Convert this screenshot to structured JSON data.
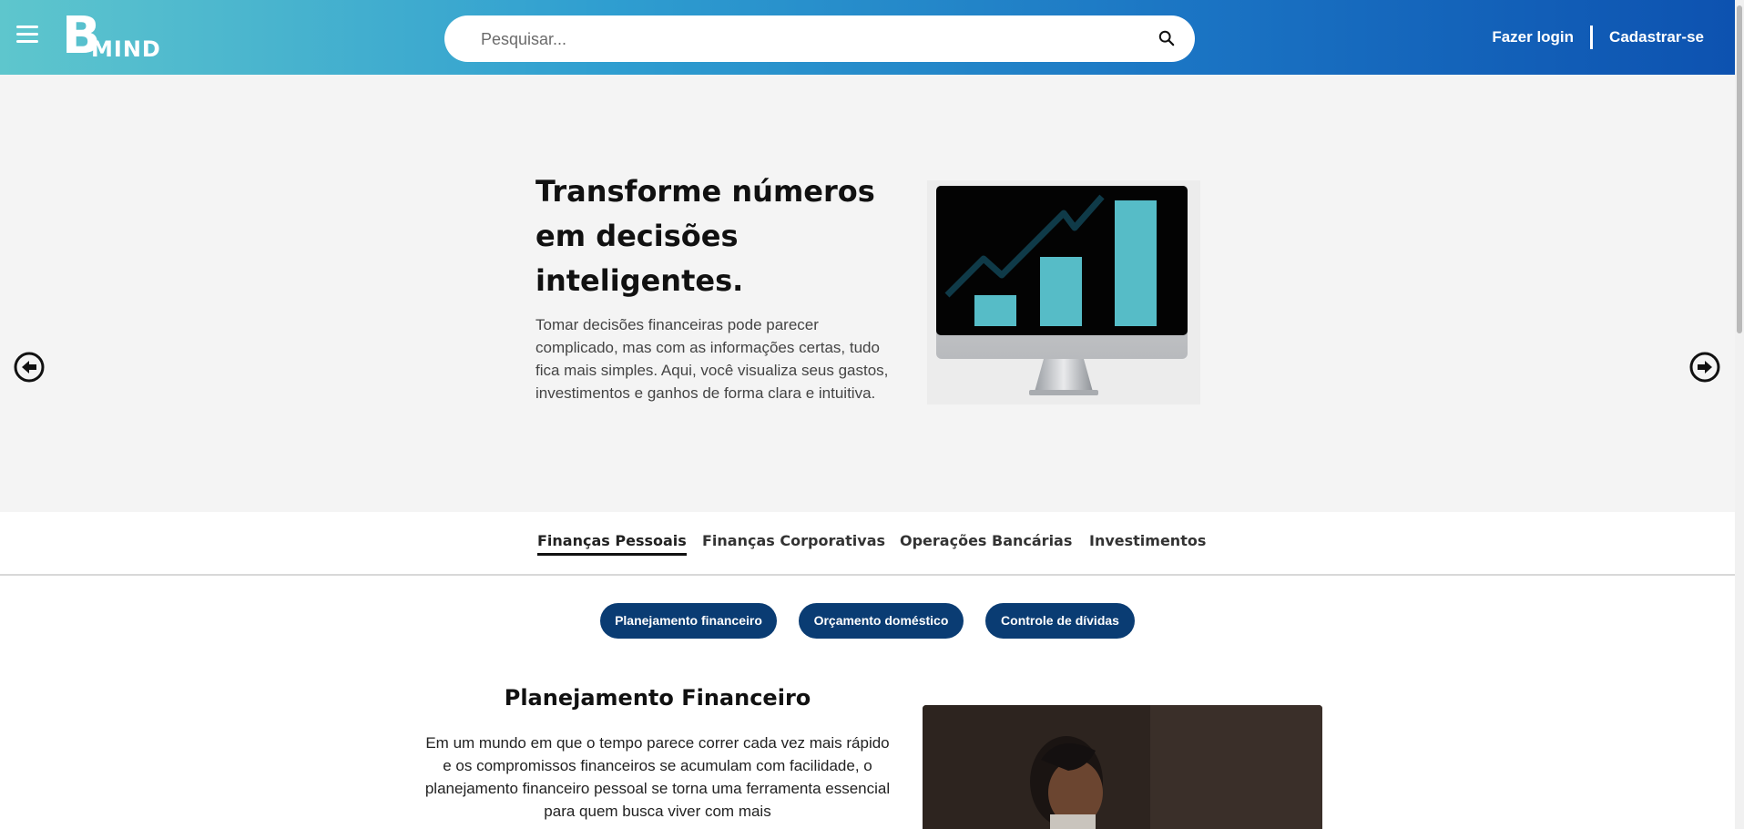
{
  "header": {
    "logo_letter": "B",
    "logo_word": "MIND",
    "search_placeholder": "Pesquisar...",
    "login_label": "Fazer login",
    "signup_label": "Cadastrar-se"
  },
  "hero": {
    "title": "Transforme números em decisões inteligentes.",
    "description": "Tomar decisões financeiras pode parecer complicado, mas com as informações certas, tudo fica mais simples. Aqui, você visualiza seus gastos, investimentos e ganhos de forma clara e intuitiva."
  },
  "tabs": [
    {
      "label": "Finanças Pessoais",
      "active": true
    },
    {
      "label": "Finanças Corporativas",
      "active": false
    },
    {
      "label": "Operações Bancárias",
      "active": false
    },
    {
      "label": "Investimentos",
      "active": false
    }
  ],
  "chips": [
    {
      "label": "Planejamento financeiro"
    },
    {
      "label": "Orçamento doméstico"
    },
    {
      "label": "Controle de dívidas"
    }
  ],
  "content": {
    "title": "Planejamento Financeiro",
    "text": "Em um mundo em que o tempo parece correr cada vez mais rápido e os compromissos financeiros se acumulam com facilidade, o planejamento financeiro pessoal se torna uma ferramenta essencial para quem busca viver com mais"
  },
  "colors": {
    "header_gradient_start": "#5ec6cd",
    "header_gradient_end": "#0d52b0",
    "chip_bg": "#0a3c73",
    "chart_bar": "#56bcc7"
  },
  "icons": {
    "menu": "hamburger-icon",
    "search": "search-icon",
    "prev": "arrow-left-circle-icon",
    "next": "arrow-right-circle-icon"
  }
}
